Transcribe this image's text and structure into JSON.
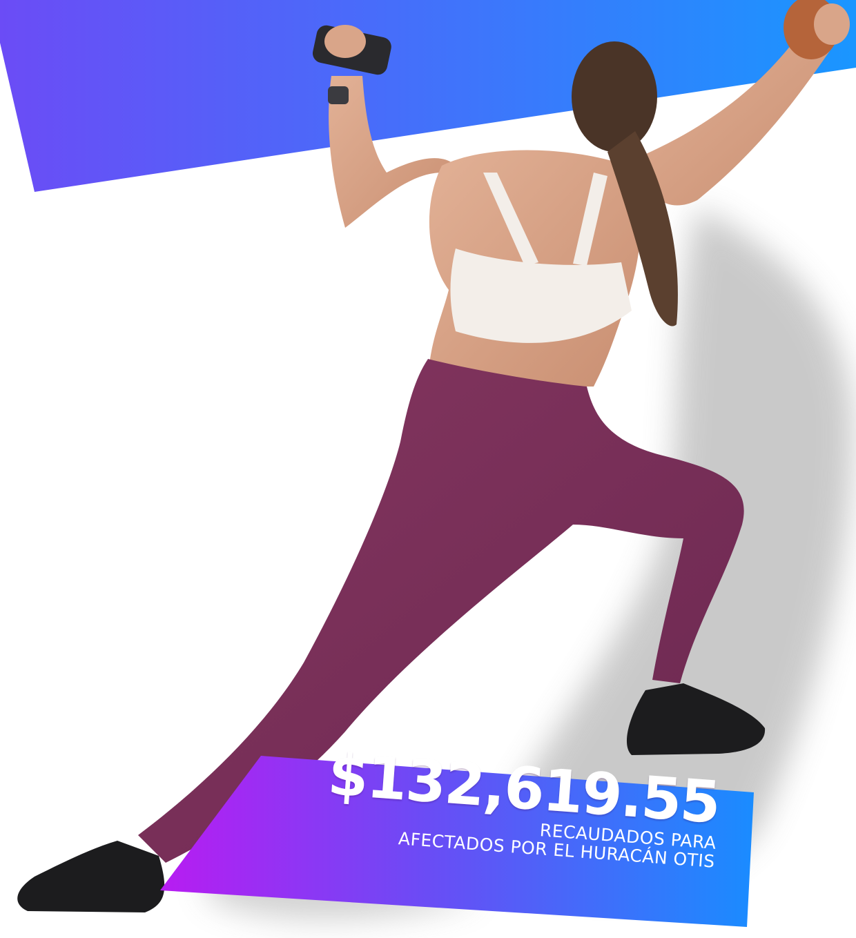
{
  "banner": {
    "amount": "$132,619.55",
    "caption_line1": "RECAUDADOS PARA",
    "caption_line2": "AFECTADOS POR EL HURACÁN OTIS"
  },
  "colors": {
    "gradient_start": "#6b4cf6",
    "gradient_end": "#1a96ff",
    "banner_start": "#b81cf2",
    "banner_mid": "#6a4cf5",
    "banner_end": "#1a8cff",
    "leggings": "#7a2f5a",
    "sports_bra": "#f3eee9",
    "skin": "#d9a589",
    "hair": "#4a3427",
    "shoes": "#1c1c1e"
  },
  "icons": [
    "athlete-illustration",
    "dumbbell-icon",
    "watch-icon"
  ]
}
